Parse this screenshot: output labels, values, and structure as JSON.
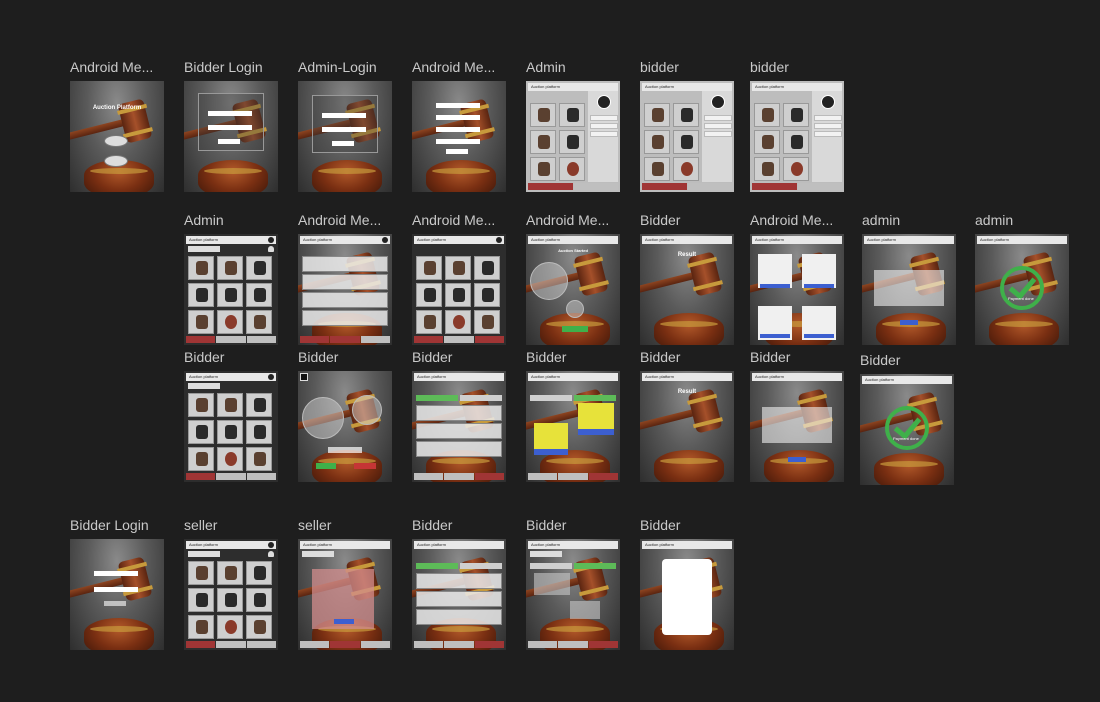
{
  "frames": [
    {
      "id": "f1",
      "label": "Android Me...",
      "kind": "home"
    },
    {
      "id": "f2",
      "label": "Bidder Login",
      "kind": "login"
    },
    {
      "id": "f3",
      "label": "Admin-Login",
      "kind": "login"
    },
    {
      "id": "f4",
      "label": "Android Me...",
      "kind": "register"
    },
    {
      "id": "f5",
      "label": "Admin",
      "kind": "menu"
    },
    {
      "id": "f6",
      "label": "bidder",
      "kind": "menu"
    },
    {
      "id": "f7",
      "label": "bidder",
      "kind": "menu"
    },
    {
      "id": "f8",
      "label": "Admin",
      "kind": "grid"
    },
    {
      "id": "f9",
      "label": "Android Me...",
      "kind": "list"
    },
    {
      "id": "f10",
      "label": "Android Me...",
      "kind": "grid"
    },
    {
      "id": "f11",
      "label": "Android Me...",
      "kind": "auction"
    },
    {
      "id": "f12",
      "label": "Bidder",
      "kind": "result"
    },
    {
      "id": "f13",
      "label": "Android Me...",
      "kind": "cards"
    },
    {
      "id": "f14",
      "label": "admin",
      "kind": "form"
    },
    {
      "id": "f15",
      "label": "admin",
      "kind": "done"
    },
    {
      "id": "f16",
      "label": "Bidder",
      "kind": "grid"
    },
    {
      "id": "f17",
      "label": "Bidder",
      "kind": "auction"
    },
    {
      "id": "f18",
      "label": "Bidder",
      "kind": "tabs"
    },
    {
      "id": "f19",
      "label": "Bidder",
      "kind": "payment"
    },
    {
      "id": "f20",
      "label": "Bidder",
      "kind": "result"
    },
    {
      "id": "f21",
      "label": "Bidder",
      "kind": "form"
    },
    {
      "id": "f22",
      "label": "Bidder",
      "kind": "done"
    },
    {
      "id": "f23",
      "label": "Bidder Login",
      "kind": "login"
    },
    {
      "id": "f24",
      "label": "seller",
      "kind": "grid"
    },
    {
      "id": "f25",
      "label": "seller",
      "kind": "sellform"
    },
    {
      "id": "f26",
      "label": "Bidder",
      "kind": "tabs"
    },
    {
      "id": "f27",
      "label": "Bidder",
      "kind": "tabs2"
    },
    {
      "id": "f28",
      "label": "Bidder",
      "kind": "receipt"
    }
  ],
  "screens": {
    "home_title": "Auction Platform",
    "appbar_title": "Auction platform",
    "result_title": "Result",
    "auction_started": "Auction Started",
    "payment_done": "Payment done",
    "payment": "Payment"
  }
}
